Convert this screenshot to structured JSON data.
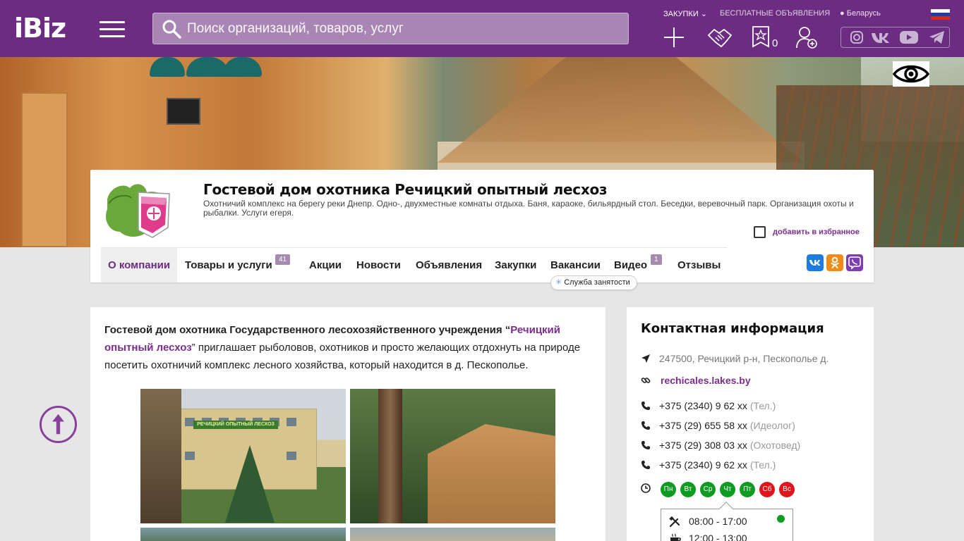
{
  "header": {
    "logo": "iBiz",
    "search_placeholder": "Поиск организаций, товаров, услуг",
    "links": {
      "purchases": "Закупки",
      "free_ads": "Бесплатные объявления",
      "location": "Беларусь"
    },
    "favorites_count": "0",
    "icons": [
      "plus-icon",
      "handshake-icon",
      "star-icon",
      "user-add-icon"
    ],
    "social_icons": [
      "instagram-icon",
      "vk-icon",
      "youtube-icon",
      "telegram-icon"
    ]
  },
  "company": {
    "title": "Гостевой дом охотника Речицкий опытный лесхоз",
    "description": "Охотничий комплекс на берегу реки Днепр. Одно-, двухместные комнаты отдыха. Баня, караоке, бильярдный стол. Беседки, веревочный парк. Организация охоты и рыбалки. Услуги егеря.",
    "add_favorite": "добавить в избранное",
    "tabs": [
      {
        "label": "О компании",
        "active": true
      },
      {
        "label": "Товары и услуги",
        "badge": "41"
      },
      {
        "label": "Акции"
      },
      {
        "label": "Новости"
      },
      {
        "label": "Объявления"
      },
      {
        "label": "Закупки"
      },
      {
        "label": "Вакансии"
      },
      {
        "label": "Видео",
        "badge": "1"
      },
      {
        "label": "Отзывы"
      }
    ],
    "employment_service": "Служба занятости",
    "share": [
      "vk-share-icon",
      "ok-share-icon",
      "viber-share-icon"
    ]
  },
  "article": {
    "intro_bold": "Гостевой дом охотника Государственного лесохозяйственного учреждения “",
    "intro_link": "Речицкий опытный лесхоз",
    "intro_rest": "” приглашает рыболовов, охотников и просто желающих отдохнуть на природе посетить охотничий комплекс лесного хозяйства, который находится в д. Пескополье.",
    "photo_sign": "РЕЧИЦКИЙ ОПЫТНЫЙ ЛЕСХОЗ"
  },
  "contacts": {
    "title": "Контактная информация",
    "address": "247500, Речицкий р-н, Пескополье д.",
    "website": "rechicales.lakes.by",
    "phones": [
      {
        "number": "+375 (2340) 9 62 xx",
        "note": "(Тел.)"
      },
      {
        "number": "+375 (29) 655 58 xx",
        "note": "(Идеолог)"
      },
      {
        "number": "+375 (29) 308 03 xx",
        "note": "(Охотовед)"
      },
      {
        "number": "+375 (2340) 9 62 xx",
        "note": "(Тел.)"
      }
    ],
    "days": [
      {
        "label": "Пн",
        "status": "work"
      },
      {
        "label": "Вт",
        "status": "work"
      },
      {
        "label": "Ср",
        "status": "work"
      },
      {
        "label": "Чт",
        "status": "work"
      },
      {
        "label": "Пт",
        "status": "work"
      },
      {
        "label": "Сб",
        "status": "off"
      },
      {
        "label": "Вс",
        "status": "off"
      }
    ],
    "hours": {
      "work": "08:00 - 17:00",
      "lunch": "12:00 - 13:00"
    }
  },
  "colors": {
    "brand": "#6c2c82",
    "link": "#7b2d8e",
    "open": "#0d9b22",
    "closed": "#e0141b"
  }
}
